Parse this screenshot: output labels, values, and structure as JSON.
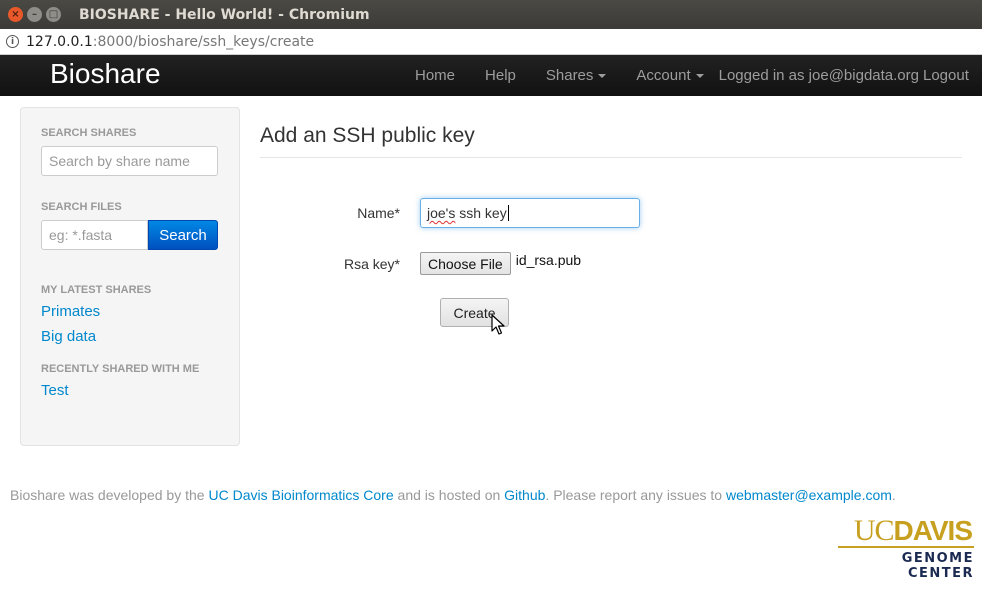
{
  "window": {
    "title": "BIOSHARE - Hello World! - Chromium",
    "url_host": "127.0.0.1",
    "url_path": ":8000/bioshare/ssh_keys/create"
  },
  "navbar": {
    "brand": "Bioshare",
    "items": [
      {
        "label": "Home"
      },
      {
        "label": "Help"
      },
      {
        "label": "Shares"
      },
      {
        "label": "Account"
      }
    ],
    "logged_in_text": "Logged in as joe@bigdata.org",
    "logout_label": "Logout"
  },
  "sidebar": {
    "search_shares_header": "SEARCH SHARES",
    "search_shares_placeholder": "Search by share name",
    "search_files_header": "SEARCH FILES",
    "search_files_placeholder": "eg: *.fasta",
    "search_button": "Search",
    "latest_shares_header": "MY LATEST SHARES",
    "latest_shares": [
      {
        "label": "Primates"
      },
      {
        "label": "Big data"
      }
    ],
    "recently_shared_header": "RECENTLY SHARED WITH ME",
    "recently_shared": [
      {
        "label": "Test"
      }
    ]
  },
  "main": {
    "title": "Add an SSH public key",
    "name_label": "Name*",
    "name_value_misspelled": "joe's",
    "name_value_rest": " ssh key",
    "rsa_label": "Rsa key*",
    "choose_file_label": "Choose File",
    "file_name": "id_rsa.pub",
    "create_button": "Create"
  },
  "footer": {
    "text1": "Bioshare was developed by the ",
    "link1": "UC Davis Bioinformatics Core",
    "text2": " and is hosted on ",
    "link2": "Github",
    "text3": ". Please report any issues to ",
    "link3": "webmaster@example.com",
    "text4": ".",
    "logo_uc": "UC",
    "logo_davis": "DAVIS",
    "logo_subtitle": "GENOME CENTER"
  },
  "colors": {
    "link": "#0088cc",
    "navbar_bg": "#1b1b1b",
    "primary_button": "#0060cc",
    "logo_gold": "#c8a020",
    "logo_navy": "#1a2a50"
  }
}
